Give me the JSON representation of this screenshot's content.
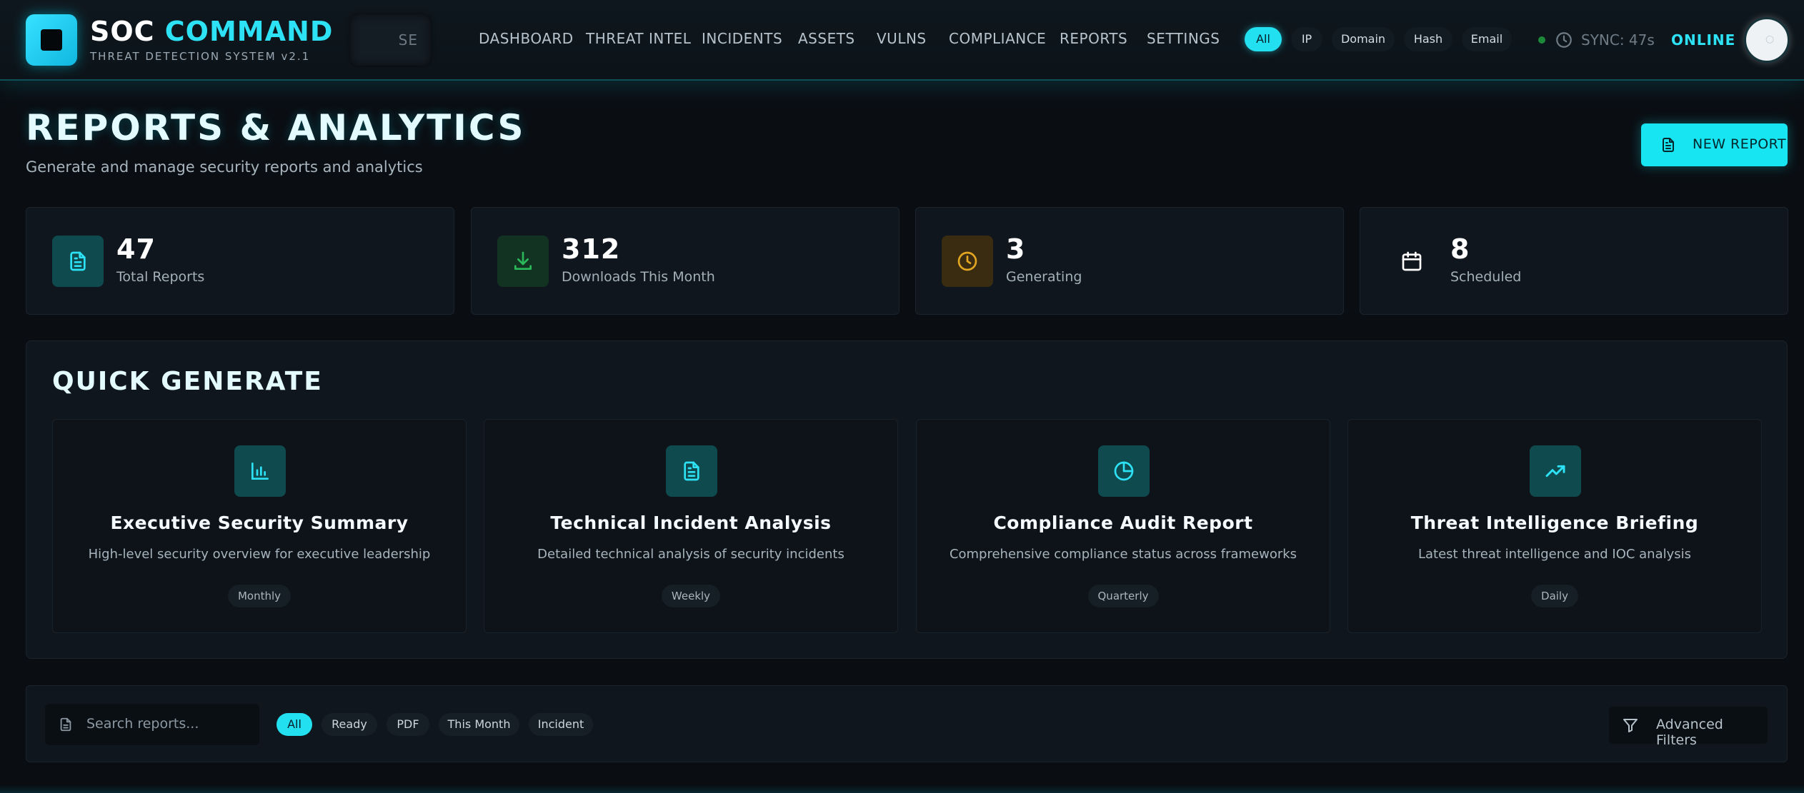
{
  "brand": {
    "title_part1": "SOC ",
    "title_part2": "COMMAND",
    "subtitle": "THREAT DETECTION SYSTEM v2.1"
  },
  "search": {
    "placeholder_visible": "SE"
  },
  "nav": [
    "DASHBOARD",
    "THREAT INTEL",
    "INCIDENTS",
    "ASSETS",
    "VULNS",
    "COMPLIANCE",
    "REPORTS",
    "SETTINGS"
  ],
  "ioc_filters": {
    "options": [
      "All",
      "IP",
      "Domain",
      "Hash",
      "Email"
    ],
    "selected": "All"
  },
  "status": {
    "sync": "SYNC: 47s",
    "connection": "ONLINE"
  },
  "page": {
    "title": "REPORTS & ANALYTICS",
    "subtitle": "Generate and manage security reports and analytics"
  },
  "actions": {
    "new_report": "NEW REPORT"
  },
  "stats": [
    {
      "value": "47",
      "label": "Total Reports",
      "icon": "document-icon"
    },
    {
      "value": "312",
      "label": "Downloads This Month",
      "icon": "download-icon"
    },
    {
      "value": "3",
      "label": "Generating",
      "icon": "clock-icon"
    },
    {
      "value": "8",
      "label": "Scheduled",
      "icon": "calendar-icon"
    }
  ],
  "quick_generate": {
    "title": "QUICK GENERATE",
    "templates": [
      {
        "name": "Executive Security Summary",
        "description": "High-level security overview for executive leadership",
        "frequency": "Monthly",
        "icon": "bar-chart-icon"
      },
      {
        "name": "Technical Incident Analysis",
        "description": "Detailed technical analysis of security incidents",
        "frequency": "Weekly",
        "icon": "document-icon"
      },
      {
        "name": "Compliance Audit Report",
        "description": "Comprehensive compliance status across frameworks",
        "frequency": "Quarterly",
        "icon": "pie-chart-icon"
      },
      {
        "name": "Threat Intelligence Briefing",
        "description": "Latest threat intelligence and IOC analysis",
        "frequency": "Daily",
        "icon": "trending-up-icon"
      }
    ]
  },
  "report_filters": {
    "search_placeholder": "Search reports...",
    "chips": [
      "All",
      "Ready",
      "PDF",
      "This Month",
      "Incident"
    ],
    "selected": "All",
    "advanced": "Advanced Filters"
  },
  "colors": {
    "accent": "#23e0f0",
    "background": "#0a0e13",
    "card": "#10161d",
    "success": "#1d8a3a",
    "warning": "#d9a21b"
  }
}
